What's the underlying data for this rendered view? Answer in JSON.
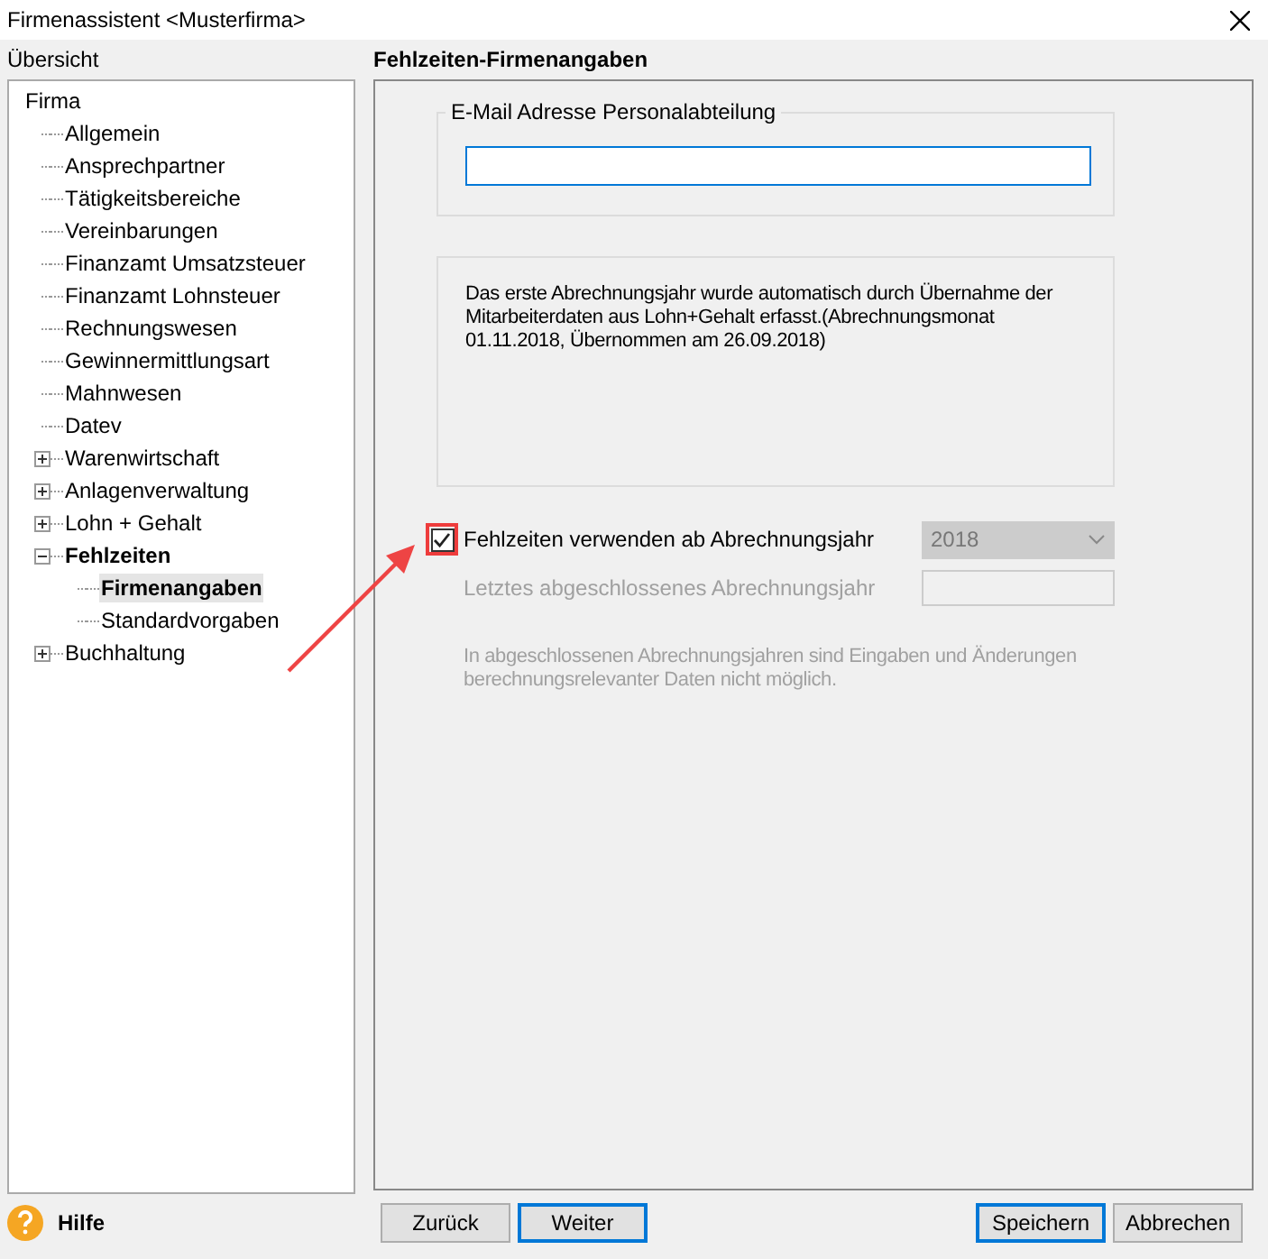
{
  "window": {
    "title": "Firmenassistent <Musterfirma>"
  },
  "sidebar": {
    "title": "Übersicht",
    "tree": [
      {
        "label": "Firma",
        "children": [
          {
            "label": "Allgemein",
            "selected": false
          },
          {
            "label": "Ansprechpartner",
            "selected": false
          },
          {
            "label": "Tätigkeitsbereiche",
            "selected": false
          },
          {
            "label": "Vereinbarungen",
            "selected": false
          },
          {
            "label": "Finanzamt Umsatzsteuer",
            "selected": false
          },
          {
            "label": "Finanzamt Lohnsteuer",
            "selected": false
          },
          {
            "label": "Rechnungswesen",
            "selected": false
          },
          {
            "label": "Gewinnermittlungsart",
            "selected": false
          },
          {
            "label": "Mahnwesen",
            "selected": false
          },
          {
            "label": "Datev",
            "selected": false
          },
          {
            "label": "Warenwirtschaft",
            "selected": false,
            "expanded": false
          },
          {
            "label": "Anlagenverwaltung",
            "selected": false,
            "expanded": false
          },
          {
            "label": "Lohn + Gehalt",
            "selected": false,
            "expanded": false
          },
          {
            "label": "Fehlzeiten",
            "selected": false,
            "bold": true,
            "expanded": true,
            "children": [
              {
                "label": "Firmenangaben",
                "selected": true
              },
              {
                "label": "Standardvorgaben",
                "selected": false
              }
            ]
          },
          {
            "label": "Buchhaltung",
            "selected": false,
            "expanded": false
          }
        ]
      }
    ]
  },
  "panel": {
    "title": "Fehlzeiten-Firmenangaben",
    "email_group": {
      "legend": "E-Mail Adresse Personalabteilung"
    },
    "info_text": "Das erste Abrechnungsjahr wurde automatisch durch Übernahme der Mitarbeiterdaten aus Lohn+Gehalt erfasst.(Abrechnungsmonat 01.11.2018, Übernommen am 26.09.2018)",
    "use_checkbox": {
      "label": "Fehlzeiten verwenden ab Abrechnungsjahr",
      "checked": true,
      "highlighted": true
    },
    "year_select": {
      "value": "2018",
      "disabled": true
    },
    "last_closed": {
      "label": "Letztes abgeschlossenes Abrechnungsjahr",
      "disabled": true
    },
    "note": "In abgeschlossenen Abrechnungsjahren sind Eingaben und Änderungen berechnungsrelevanter Daten nicht möglich."
  },
  "footer": {
    "help": "Hilfe",
    "buttons": [
      {
        "label": "Zurück",
        "focused": false
      },
      {
        "label": "Weiter",
        "focused": true
      },
      {
        "label": "Speichern",
        "focused": true
      },
      {
        "label": "Abbrechen",
        "focused": false
      }
    ]
  }
}
